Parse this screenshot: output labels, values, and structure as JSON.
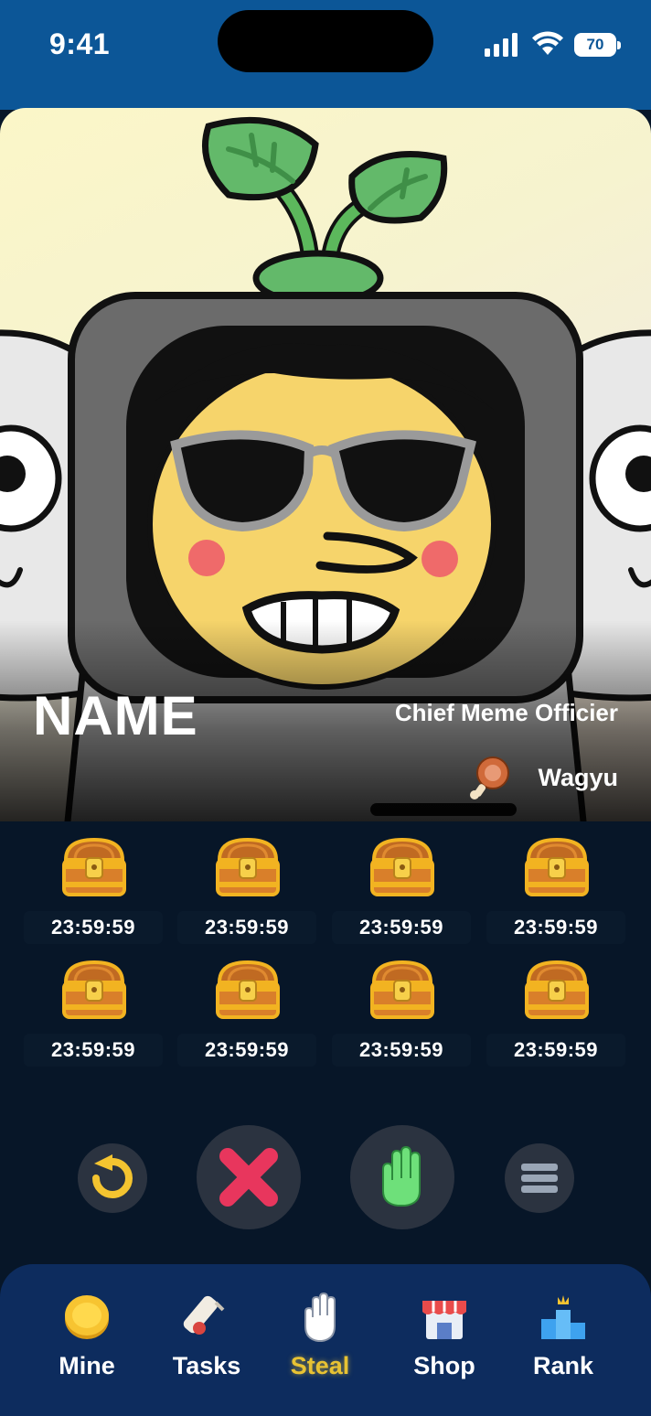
{
  "status_bar": {
    "time": "9:41",
    "battery": "70"
  },
  "profile": {
    "name": "NAME",
    "title": "Chief Meme Officier",
    "item_label": "Wagyu",
    "item_icon": "meat-icon"
  },
  "chests": [
    {
      "timer": "23:59:59",
      "icon": "treasure-chest-icon"
    },
    {
      "timer": "23:59:59",
      "icon": "treasure-chest-icon"
    },
    {
      "timer": "23:59:59",
      "icon": "treasure-chest-icon"
    },
    {
      "timer": "23:59:59",
      "icon": "treasure-chest-icon"
    },
    {
      "timer": "23:59:59",
      "icon": "treasure-chest-icon"
    },
    {
      "timer": "23:59:59",
      "icon": "treasure-chest-icon"
    },
    {
      "timer": "23:59:59",
      "icon": "treasure-chest-icon"
    },
    {
      "timer": "23:59:59",
      "icon": "treasure-chest-icon"
    }
  ],
  "actions": [
    {
      "icon": "undo-icon",
      "color": "#f4c430"
    },
    {
      "icon": "close-icon",
      "color": "#e8365d"
    },
    {
      "icon": "hand-icon",
      "color": "#6ee07a"
    },
    {
      "icon": "menu-icon",
      "color": "#9aa6b6"
    }
  ],
  "tabs": [
    {
      "label": "Mine",
      "icon": "coin-icon",
      "active": false
    },
    {
      "label": "Tasks",
      "icon": "scroll-icon",
      "active": false
    },
    {
      "label": "Steal",
      "icon": "hand-icon",
      "active": true
    },
    {
      "label": "Shop",
      "icon": "shop-icon",
      "active": false
    },
    {
      "label": "Rank",
      "icon": "trophy-icon",
      "active": false
    }
  ],
  "colors": {
    "status_bg": "#0c5697",
    "page_bg": "#071628",
    "tabbar_bg": "#0d2c5e",
    "active_tab": "#e7c233"
  }
}
